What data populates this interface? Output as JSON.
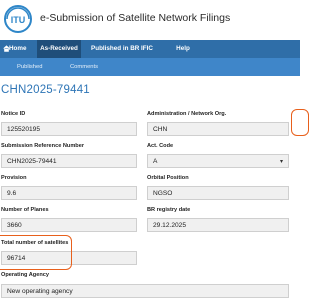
{
  "header": {
    "app_title": "e-Submission of Satellite Network Filings",
    "logo_icon": "itu-logo-icon"
  },
  "nav": {
    "items": [
      {
        "label": "Home",
        "icon": "home-icon"
      },
      {
        "label": "As-Received"
      },
      {
        "label": "Published in BR IFIC"
      },
      {
        "label": "Help"
      }
    ],
    "active": "As-Received",
    "color": "#2f6ea8",
    "active_color": "#1f4e7a"
  },
  "subnav": {
    "items": [
      {
        "label": "Published"
      },
      {
        "label": "Comments"
      }
    ],
    "color": "#3f86c9"
  },
  "notice": {
    "title": "CHN2025-79441"
  },
  "form": {
    "notice_id": {
      "label": "Notice ID",
      "value": "125520195"
    },
    "administration": {
      "label": "Administration / Network Org.",
      "value": "CHN"
    },
    "submission_ref": {
      "label": "Submission Reference Number",
      "value": "CHN2025-79441"
    },
    "act_code": {
      "label": "Act. Code",
      "value": "A",
      "arrow_icon": "chevron-down-icon"
    },
    "provision": {
      "label": "Provision",
      "value": "9.6"
    },
    "orbital_position": {
      "label": "Orbital Position",
      "value": "NGSO"
    },
    "number_of_planes": {
      "label": "Number of Planes",
      "value": "3660"
    },
    "br_registry_date": {
      "label": "BR registry date",
      "value": "29.12.2025"
    },
    "total_satellites": {
      "label": "Total number of satellites",
      "value": "96714"
    },
    "operating_agency": {
      "label": "Operating Agency",
      "value": "New operating agency"
    }
  },
  "highlight_color": "#e8601c"
}
